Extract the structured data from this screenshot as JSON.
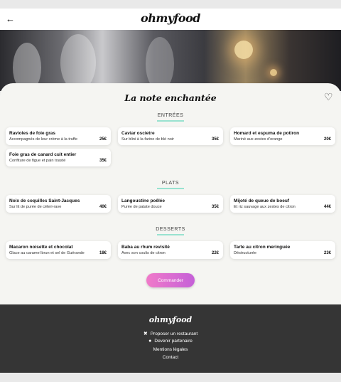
{
  "header": {
    "back_icon": "arrow-left-icon",
    "logo": "ohmyfood"
  },
  "restaurant": {
    "title": "La note enchantée",
    "favorite_icon": "heart-outline-icon"
  },
  "sections": {
    "entrees": {
      "title": "ENTRÉES",
      "items": [
        {
          "name": "Ravioles de foie gras",
          "desc": "Accompagnés de leur crème à la truffe",
          "price": "25€"
        },
        {
          "name": "Caviar oscietre",
          "desc": "Sur blini à la farine de blé noir",
          "price": "35€"
        },
        {
          "name": "Homard et espuma de potiron",
          "desc": "Mariné aux zestes d'orange",
          "price": "20€"
        },
        {
          "name": "Foie gras de canard cuit entier",
          "desc": "Confiture de figue et pain toasté",
          "price": "35€"
        }
      ]
    },
    "plats": {
      "title": "PLATS",
      "items": [
        {
          "name": "Noix de coquilles Saint-Jacques",
          "desc": "Sur lit de purée de céleri-rave",
          "price": "40€"
        },
        {
          "name": "Langoustine poêlée",
          "desc": "Purée de patate douce",
          "price": "35€"
        },
        {
          "name": "Mijoté de queue de boeuf",
          "desc": "Et riz sauvage aux zestes de citron",
          "price": "44€"
        }
      ]
    },
    "desserts": {
      "title": "DESSERTS",
      "items": [
        {
          "name": "Macaron noisette et chocolat",
          "desc": "Glace au caramel brun et sel de Guérande",
          "price": "18€"
        },
        {
          "name": "Baba au rhum revisité",
          "desc": "Avec son coulis de citron",
          "price": "22€"
        },
        {
          "name": "Tarte au citron meringuée",
          "desc": "Déstructurée",
          "price": "23€"
        }
      ]
    }
  },
  "order_button": "Commander",
  "footer": {
    "logo": "ohmyfood",
    "links": {
      "propose": {
        "label": "Proposer un restaurant",
        "icon": "utensils-icon"
      },
      "partner": {
        "label": "Devenir partenaire",
        "icon": "handshake-icon"
      },
      "legal": {
        "label": "Mentions légales"
      },
      "contact": {
        "label": "Contact"
      }
    }
  },
  "colors": {
    "accent_pink": "#f07ac9",
    "accent_purple": "#c560d8",
    "section_underline": "#99e2d0",
    "footer_bg": "#353535"
  }
}
